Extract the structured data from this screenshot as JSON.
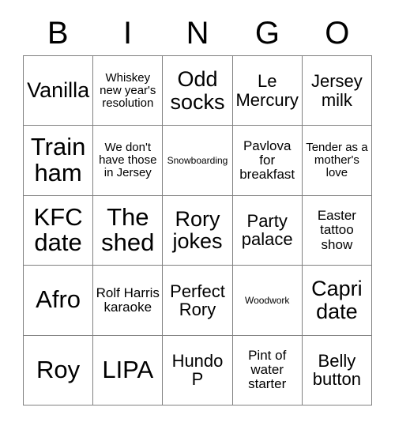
{
  "card": {
    "header_letters": [
      "B",
      "I",
      "N",
      "G",
      "O"
    ],
    "rows": [
      [
        {
          "text": "Vanilla",
          "size": "lg"
        },
        {
          "text": "Whiskey new year's resolution",
          "size": "xs"
        },
        {
          "text": "Odd socks",
          "size": "lg"
        },
        {
          "text": "Le Mercury",
          "size": "md"
        },
        {
          "text": "Jersey milk",
          "size": "md"
        }
      ],
      [
        {
          "text": "Train ham",
          "size": "xl"
        },
        {
          "text": "We don't have those in Jersey",
          "size": "xs"
        },
        {
          "text": "Snowboarding",
          "size": "xxs"
        },
        {
          "text": "Pavlova for breakfast",
          "size": "sm"
        },
        {
          "text": "Tender as a mother's love",
          "size": "xs"
        }
      ],
      [
        {
          "text": "KFC date",
          "size": "xl"
        },
        {
          "text": "The shed",
          "size": "xl"
        },
        {
          "text": "Rory jokes",
          "size": "lg"
        },
        {
          "text": "Party palace",
          "size": "md"
        },
        {
          "text": "Easter tattoo show",
          "size": "sm"
        }
      ],
      [
        {
          "text": "Afro",
          "size": "xl"
        },
        {
          "text": "Rolf Harris karaoke",
          "size": "sm"
        },
        {
          "text": "Perfect Rory",
          "size": "md"
        },
        {
          "text": "Woodwork",
          "size": "xxs"
        },
        {
          "text": "Capri date",
          "size": "lg"
        }
      ],
      [
        {
          "text": "Roy",
          "size": "xl"
        },
        {
          "text": "LIPA",
          "size": "xl"
        },
        {
          "text": "Hundo P",
          "size": "md"
        },
        {
          "text": "Pint of water starter",
          "size": "sm"
        },
        {
          "text": "Belly button",
          "size": "md"
        }
      ]
    ]
  },
  "colors": {
    "background": "#ffffff",
    "text": "#000000",
    "grid_line": "#808080"
  }
}
